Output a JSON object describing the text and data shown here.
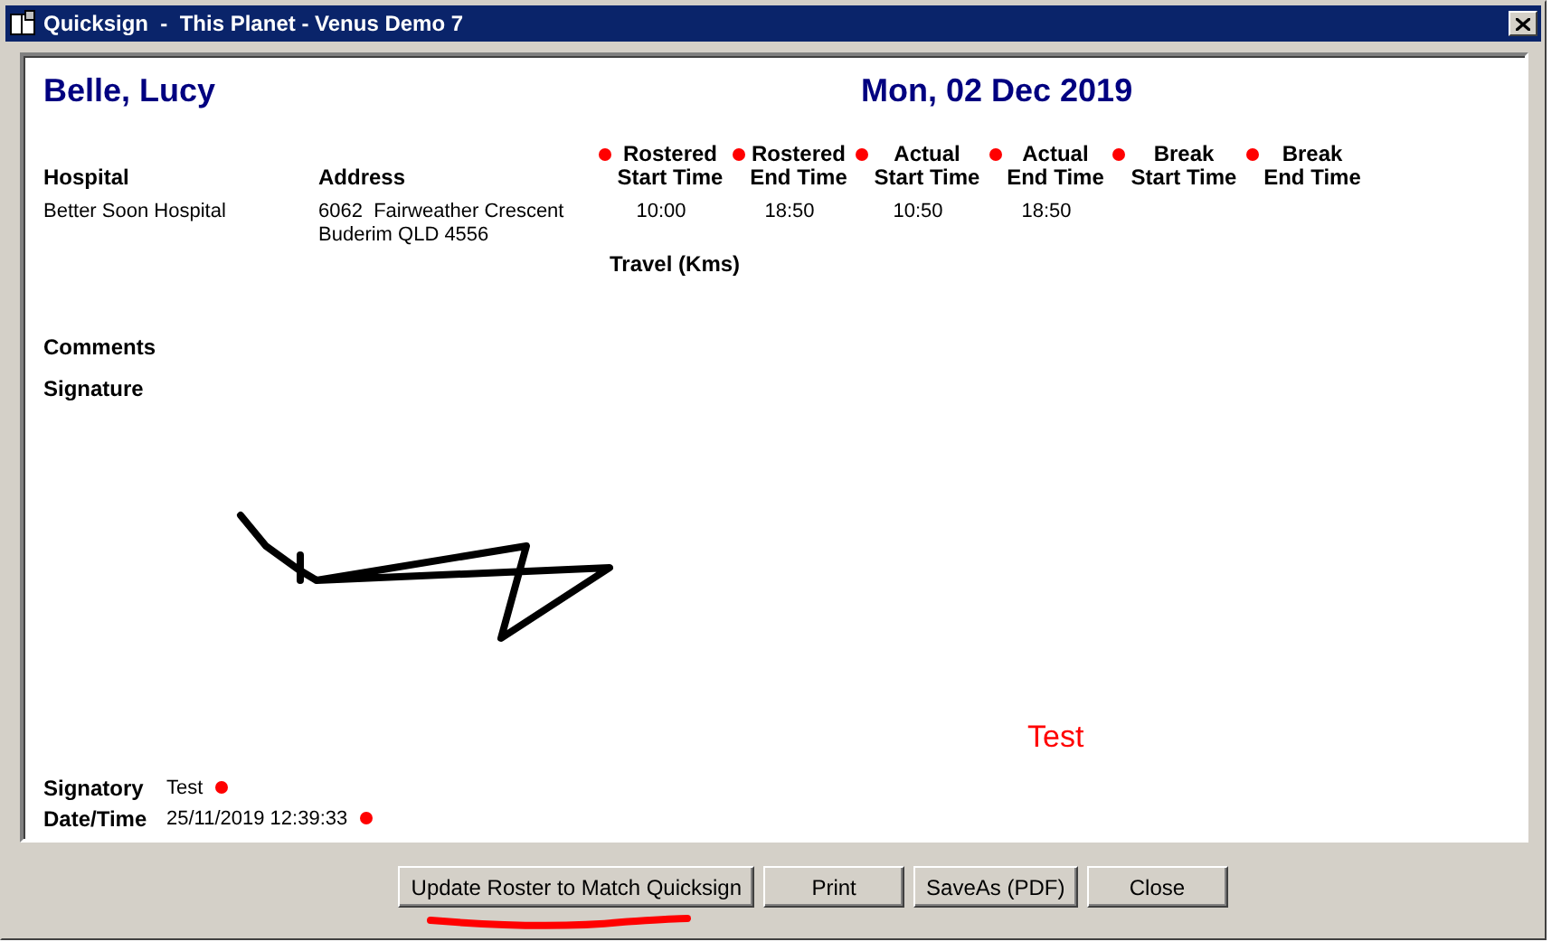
{
  "window": {
    "title": "Quicksign  -  This Planet - Venus Demo 7"
  },
  "employee": "Belle, Lucy",
  "date": "Mon, 02 Dec 2019",
  "columns": [
    {
      "label": "Hospital"
    },
    {
      "label": "Address"
    },
    {
      "label": "Rostered\nStart Time",
      "flagged": true
    },
    {
      "label": "Rostered\nEnd Time",
      "flagged": true
    },
    {
      "label": "Actual\nStart Time",
      "flagged": true
    },
    {
      "label": "Actual\nEnd Time",
      "flagged": true
    },
    {
      "label": "Break\nStart Time",
      "flagged": true
    },
    {
      "label": "Break\nEnd Time",
      "flagged": true
    }
  ],
  "row": {
    "hospital": "Better Soon Hospital",
    "address": "6062  Fairweather Crescent\nBuderim QLD 4556",
    "times": [
      "10:00",
      "18:50",
      "10:50",
      "18:50"
    ]
  },
  "travel_label": "Travel (Kms)",
  "comments_label": "Comments",
  "signature_label": "Signature",
  "signature_name": "Test",
  "signatory": {
    "label": "Signatory",
    "value": "Test",
    "flagged": true
  },
  "datetime": {
    "label": "Date/Time",
    "value": "25/11/2019 12:39:33",
    "flagged": true
  },
  "buttons": [
    {
      "label": "Update Roster to Match Quicksign",
      "highlighted": true
    },
    {
      "label": "Print",
      "highlighted": false
    },
    {
      "label": "SaveAs (PDF)",
      "highlighted": false
    },
    {
      "label": "Close",
      "highlighted": false
    }
  ]
}
